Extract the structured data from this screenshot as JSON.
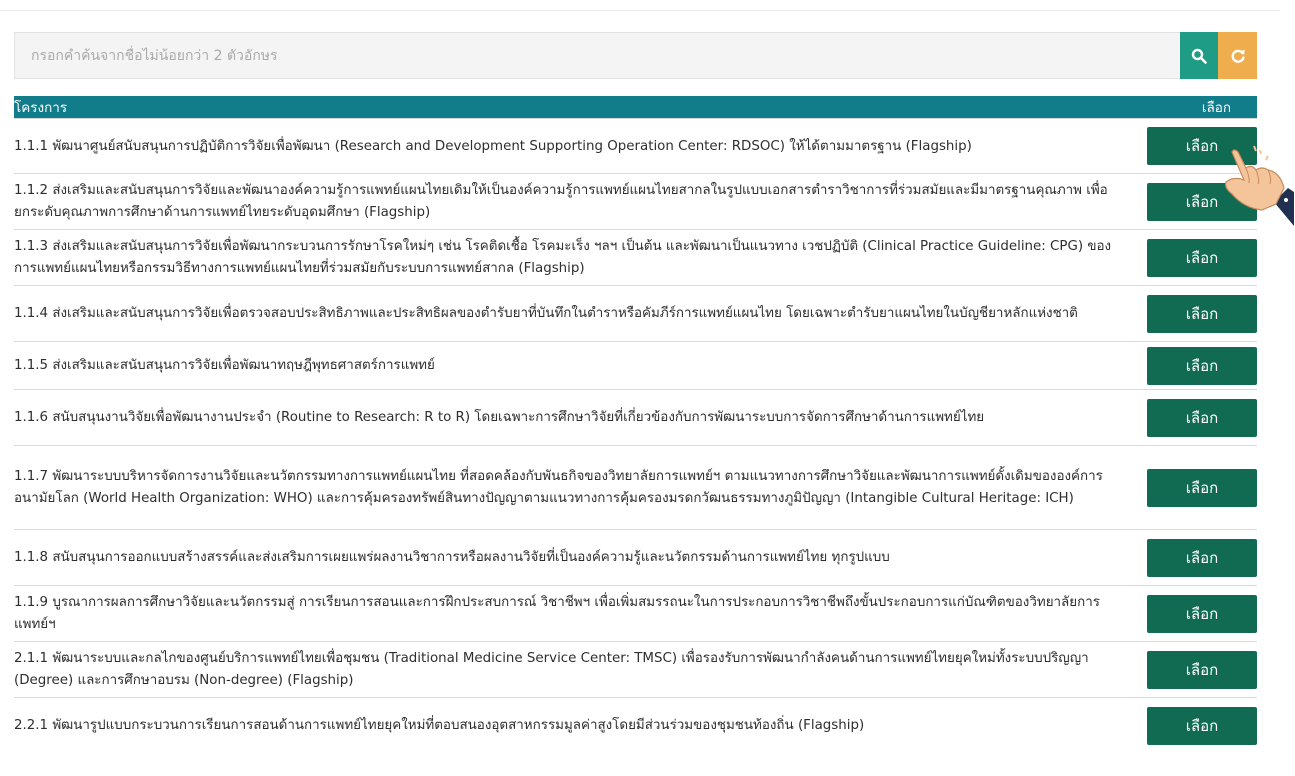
{
  "search": {
    "placeholder": "กรอกคำค้นจากชื่อไม่น้อยกว่า 2 ตัวอักษร",
    "search_icon": "search-icon",
    "reset_icon": "refresh-icon",
    "search_color": "#1e9c86",
    "reset_color": "#f0ad4e"
  },
  "table": {
    "header_color": "#117c8a",
    "button_color": "#106b52",
    "headers": {
      "name": "โครงการ",
      "action": "เลือก"
    },
    "rows": [
      {
        "name": "1.1.1 พัฒนาศูนย์สนับสนุนการปฏิบัติการวิจัยเพื่อพัฒนา (Research and Development Supporting Operation Center: RDSOC) ให้ได้ตามมาตรฐาน (Flagship)",
        "button": "เลือก"
      },
      {
        "name": "1.1.2 ส่งเสริมและสนับสนุนการวิจัยและพัฒนาองค์ความรู้การแพทย์แผนไทยเดิมให้เป็นองค์ความรู้การแพทย์แผนไทยสากลในรูปแบบเอกสารตำราวิชาการที่ร่วมสมัยและมีมาตรฐานคุณภาพ เพื่อยกระดับคุณภาพการศึกษาด้านการแพทย์ไทยระดับอุดมศึกษา (Flagship)",
        "button": "เลือก"
      },
      {
        "name": "1.1.3 ส่งเสริมและสนับสนุนการวิจัยเพื่อพัฒนากระบวนการรักษาโรคใหม่ๆ เช่น โรคติดเชื้อ โรคมะเร็ง ฯลฯ เป็นต้น และพัฒนาเป็นแนวทาง เวชปฏิบัติ (Clinical Practice Guideline: CPG) ของการแพทย์แผนไทยหรือกรรมวิธีทางการแพทย์แผนไทยที่ร่วมสมัยกับระบบการแพทย์สากล (Flagship)",
        "button": "เลือก"
      },
      {
        "name": "1.1.4 ส่งเสริมและสนับสนุนการวิจัยเพื่อตรวจสอบประสิทธิภาพและประสิทธิผลของตำรับยาที่บันทึกในตำราหรือคัมภีร์การแพทย์แผนไทย โดยเฉพาะตำรับยาแผนไทยในบัญชียาหลักแห่งชาติ",
        "button": "เลือก"
      },
      {
        "name": "1.1.5 ส่งเสริมและสนับสนุนการวิจัยเพื่อพัฒนาทฤษฎีพุทธศาสตร์การแพทย์",
        "button": "เลือก"
      },
      {
        "name": "1.1.6 สนับสนุนงานวิจัยเพื่อพัฒนางานประจำ (Routine to Research: R to R) โดยเฉพาะการศึกษาวิจัยที่เกี่ยวข้องกับการพัฒนาระบบการจัดการศึกษาด้านการแพทย์ไทย",
        "button": "เลือก"
      },
      {
        "name": "1.1.7 พัฒนาระบบบริหารจัดการงานวิจัยและนวัตกรรมทางการแพทย์แผนไทย ที่สอดคล้องกับพันธกิจของวิทยาลัยการแพทย์ฯ ตามแนวทางการศึกษาวิจัยและพัฒนาการแพทย์ดั้งเดิมขององค์การอนามัยโลก (World Health Organization: WHO) และการคุ้มครองทรัพย์สินทางปัญญาตามแนวทางการคุ้มครองมรดกวัฒนธรรมทางภูมิปัญญา (Intangible Cultural Heritage: ICH)",
        "button": "เลือก"
      },
      {
        "name": "1.1.8 สนับสนุนการออกแบบสร้างสรรค์และส่งเสริมการเผยแพร่ผลงานวิชาการหรือผลงานวิจัยที่เป็นองค์ความรู้และนวัตกรรมด้านการแพทย์ไทย ทุกรูปแบบ",
        "button": "เลือก"
      },
      {
        "name": "1.1.9 บูรณาการผลการศึกษาวิจัยและนวัตกรรมสู่ การเรียนการสอนและการฝึกประสบการณ์ วิชาชีพฯ เพื่อเพิ่มสมรรถนะในการประกอบการวิชาชีพถึงขั้นประกอบการแก่บัณฑิตของวิทยาลัยการแพทย์ฯ",
        "button": "เลือก"
      },
      {
        "name": "2.1.1 พัฒนาระบบและกลไกของศูนย์บริการแพทย์ไทยเพื่อชุมชน (Traditional Medicine Service Center: TMSC) เพื่อรองรับการพัฒนากำลังคนด้านการแพทย์ไทยยุคใหม่ทั้งระบบปริญญา (Degree) และการศึกษาอบรม (Non-degree) (Flagship)",
        "button": "เลือก"
      },
      {
        "name": "2.2.1 พัฒนารูปแบบกระบวนการเรียนการสอนด้านการแพทย์ไทยยุคใหม่ที่ตอบสนองอุตสาหกรรมมูลค่าสูงโดยมีส่วนร่วมของชุมชนท้องถิ่น (Flagship)",
        "button": "เลือก"
      }
    ]
  },
  "cursor_icon": "pointing-hand-icon"
}
